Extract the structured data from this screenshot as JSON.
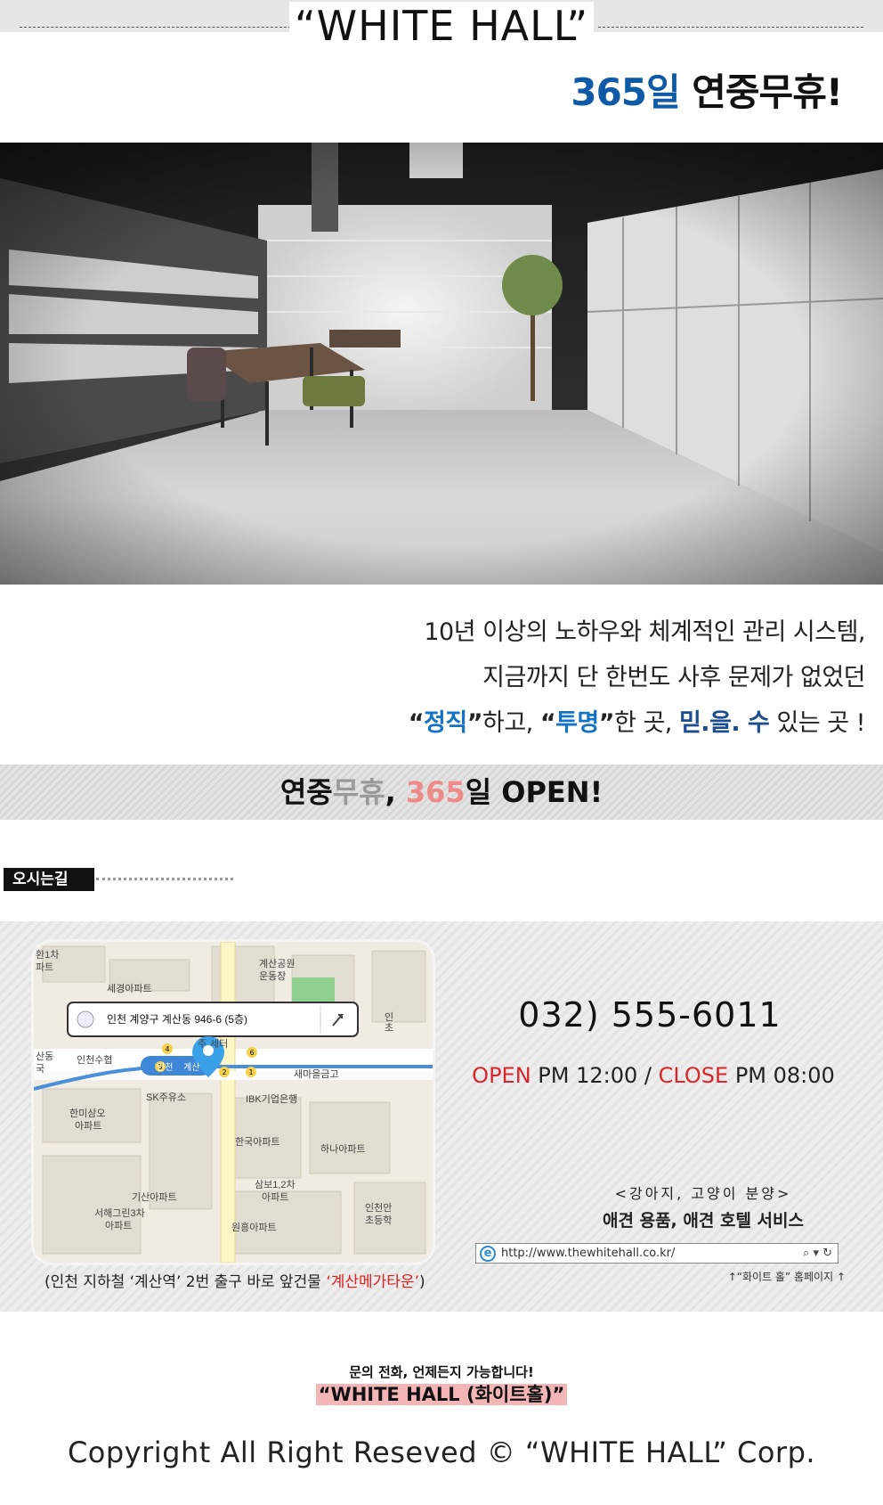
{
  "header": {
    "title": "“WHITE HALL”",
    "slogan_num": "365일",
    "slogan_text": "연중무휴!"
  },
  "photo": {
    "alt": "interior"
  },
  "description": {
    "line1": "10년 이상의 노하우와 체계적인 관리 시스템,",
    "line2": "지금까지 단 한번도 사후 문제가 없었던",
    "line3_q1_open": "“",
    "line3_word1": "정직",
    "line3_q1_close": "”",
    "line3_mid1": "하고, ",
    "line3_q2_open": "“",
    "line3_word2": "투명",
    "line3_q2_close": "”",
    "line3_mid2": "한 곳, ",
    "line3_word3": "믿.을. 수",
    "line3_end": " 있는 곳 !"
  },
  "open_banner": {
    "part1": "연중",
    "part2": "무휴",
    "part3": ", ",
    "part4": "365",
    "part5": "일 OPEN!"
  },
  "directions": {
    "tab_label": "오시는길"
  },
  "map": {
    "address": "인천 계양구 계산동 946-6 (5층)",
    "labels": {
      "l1": "환1차",
      "l2": "파트",
      "l3": "세경아파트",
      "l4": "계산공원",
      "l5": "운동장",
      "l6": "산동",
      "l7": "국",
      "l8": "인천수협",
      "l9": "새마을금고",
      "l10": "SK주유소",
      "l11": "IBK기업은행",
      "l12": "한미삼오",
      "l13": "아파트",
      "l14": "한국아파트",
      "l15": "하나아파트",
      "l16": "삼보1,2차",
      "l17": "아파트",
      "l18": "기산아파트",
      "l19": "서해그린3차",
      "l20": "아파트",
      "l21": "인천안",
      "l22": "초등학",
      "l23": "원흥아파트",
      "l24": "주",
      "l25": "세터",
      "l26": "인천",
      "l27": "계산",
      "l28": "인",
      "l29": "초"
    }
  },
  "map_caption": {
    "text": "(인천 지하철 ‘계산역’ 2번 출구 바로 앞건물 ",
    "highlight": "‘계산메가타운’",
    "close": ")"
  },
  "contact": {
    "phone": "032) 555-6011",
    "open_label": "OPEN",
    "open_time": "PM 12:00 / ",
    "close_label": "CLOSE",
    "close_time": "PM 08:00"
  },
  "services": {
    "sub": "<강아지, 고양이 분양>",
    "main": "애견 용품, 애견 호텔 서비스"
  },
  "urlbar": {
    "url": "http://www.thewhitehall.co.kr/",
    "tools": "⌕ ▾ ↻"
  },
  "home_note": "↑“화이트 홀” 홈페이지 ↑",
  "footer": {
    "contact_line": "문의 전화, 언제든지 가능합니다!",
    "contact_brand": "“WHITE HALL (화이트홀)”",
    "copyright": "Copyright All Right Reseved © “WHITE HALL” Corp."
  },
  "colors": {
    "accent_blue": "#0e5aa6",
    "red": "#d8262b",
    "pink_highlight": "#f3b5b5"
  }
}
